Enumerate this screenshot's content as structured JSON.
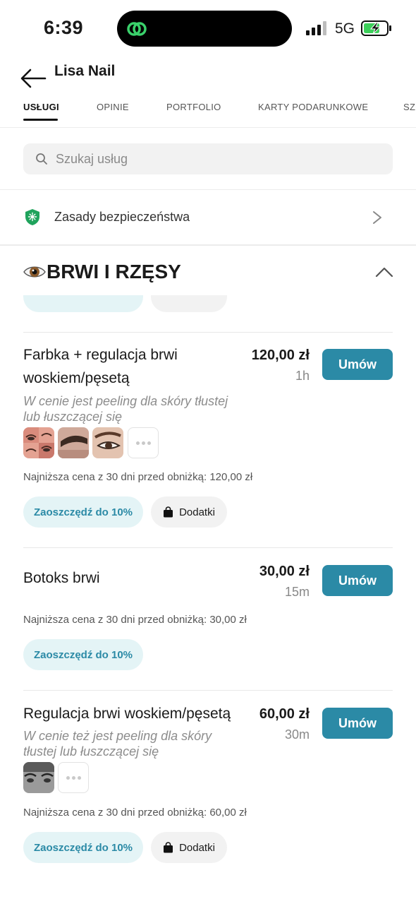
{
  "status_bar": {
    "time": "6:39",
    "network": "5G"
  },
  "header": {
    "title": "Lisa Nail"
  },
  "tabs": [
    {
      "label": "USŁUGI"
    },
    {
      "label": "OPINIE"
    },
    {
      "label": "PORTFOLIO"
    },
    {
      "label": "KARTY PODARUNKOWE"
    },
    {
      "label": "SZC"
    }
  ],
  "search": {
    "placeholder": "Szukaj usług",
    "value": ""
  },
  "safety": {
    "label": "Zasady bezpieczeństwa"
  },
  "section": {
    "title": "BRWI I RZĘSY",
    "icon": "eye-emoji"
  },
  "services": [
    {
      "name": "Farbka + regulacja brwi woskiem/pęsetą",
      "description": "W cenie jest peeling dla skóry tłustej lub łuszczącej się",
      "price": "120,00 zł",
      "duration": "1h",
      "book_label": "Umów",
      "lowest_price": "Najniższa cena z 30 dni przed obniżką: 120,00 zł",
      "save_label": "Zaoszczędź do 10%",
      "addons_label": "Dodatki",
      "photos": 3
    },
    {
      "name": "Botoks brwi",
      "price": "30,00 zł",
      "duration": "15m",
      "book_label": "Umów",
      "lowest_price": "Najniższa cena z 30 dni przed obniżką: 30,00 zł",
      "save_label": "Zaoszczędź do 10%"
    },
    {
      "name": "Regulacja brwi woskiem/pęsetą",
      "description": "W cenie też jest peeling dla skóry tłustej lub  łuszczącej się",
      "price": "60,00 zł",
      "duration": "30m",
      "book_label": "Umów",
      "lowest_price": "Najniższa cena z 30 dni przed obniżką: 60,00 zł",
      "save_label": "Zaoszczędź do 10%",
      "addons_label": "Dodatki",
      "photos": 1
    }
  ],
  "colors": {
    "accent": "#2b8aa6",
    "accent_light": "#e4f4f6",
    "safety_green": "#1fa35c"
  }
}
